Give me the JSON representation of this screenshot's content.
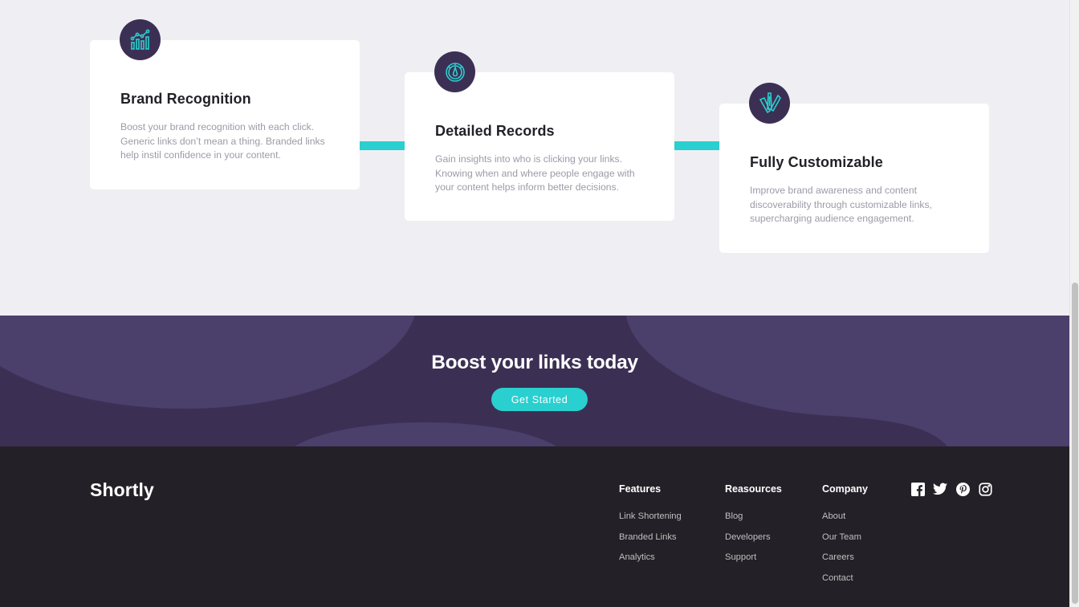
{
  "features": [
    {
      "title": "Brand Recognition",
      "text": "Boost your brand recognition with each click. Generic links don’t mean a thing. Branded links help instil confidence in your content.",
      "icon": "chart-icon"
    },
    {
      "title": "Detailed Records",
      "text": "Gain insights into who is clicking your links. Knowing when and where people engage with your content helps inform better decisions.",
      "icon": "gauge-icon"
    },
    {
      "title": "Fully Customizable",
      "text": "Improve brand awareness and content discoverability through customizable links, supercharging audience engagement.",
      "icon": "brush-pen-icon"
    }
  ],
  "boost": {
    "title": "Boost your links today",
    "cta_label": "Get Started"
  },
  "footer": {
    "logo": "Shortly",
    "columns": [
      {
        "title": "Features",
        "links": [
          "Link Shortening",
          "Branded Links",
          "Analytics"
        ]
      },
      {
        "title": "Reasources",
        "links": [
          "Blog",
          "Developers",
          "Support"
        ]
      },
      {
        "title": "Company",
        "links": [
          "About",
          "Our Team",
          "Careers",
          "Contact"
        ]
      }
    ],
    "socials": [
      "facebook-icon",
      "twitter-icon",
      "pinterest-icon",
      "instagram-icon"
    ]
  },
  "colors": {
    "cyan": "#2acfcf",
    "dark_violet": "#3b3054",
    "very_dark": "#232127",
    "grayish_violet": "#9e9aa7",
    "light_bg": "#efeef3"
  }
}
